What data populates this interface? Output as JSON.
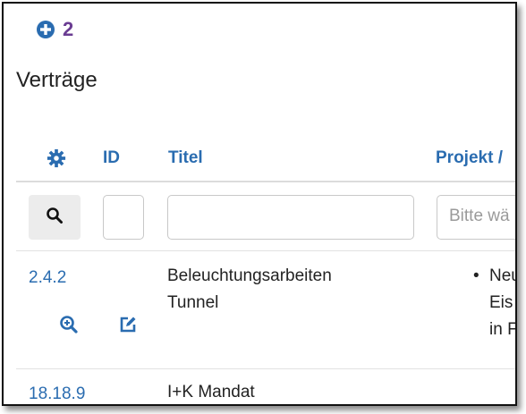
{
  "toolbar": {
    "add_count": "2",
    "add_icon": "plus-circle-icon"
  },
  "page": {
    "title": "Verträge"
  },
  "table": {
    "columns": {
      "settings_icon": "gear-icon",
      "id": "ID",
      "title": "Titel",
      "project": "Projekt /"
    },
    "filters": {
      "search_icon": "search-icon",
      "id_value": "",
      "title_value": "",
      "project_placeholder": "Bitte wä"
    },
    "rows": [
      {
        "id": "2.4.2",
        "title_lines": [
          "Beleuchtungsarbeiten",
          "Tunnel"
        ],
        "project_lines": [
          "Neu",
          "Eis",
          "in F"
        ],
        "view_icon": "zoom-in-icon",
        "edit_icon": "edit-icon"
      },
      {
        "id": "18.18.9",
        "title_lines": [
          "I+K Mandat"
        ]
      }
    ]
  },
  "colors": {
    "link": "#2a6cb0",
    "accent_count": "#6a3c92",
    "text": "#222222"
  }
}
